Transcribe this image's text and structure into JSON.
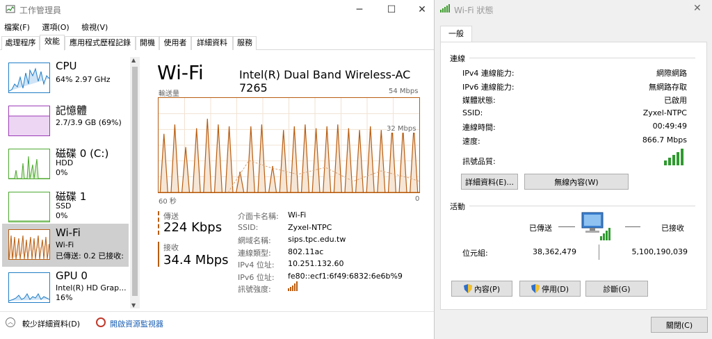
{
  "task_manager": {
    "title": "工作管理員",
    "menu": [
      "檔案(F)",
      "選項(O)",
      "檢視(V)"
    ],
    "tabs": [
      "處理程序",
      "效能",
      "應用程式歷程記錄",
      "開機",
      "使用者",
      "詳細資料",
      "服務"
    ],
    "active_tab": "效能",
    "sidebar": [
      {
        "title": "CPU",
        "line1": "64%  2.97 GHz",
        "line2": "",
        "color": "#1f7dc5"
      },
      {
        "title": "記憶體",
        "line1": "2.7/3.9 GB (69%)",
        "line2": "",
        "color": "#9b3ab5"
      },
      {
        "title": "磁碟 0 (C:)",
        "line1": "HDD",
        "line2": "0%",
        "color": "#4ca82e"
      },
      {
        "title": "磁碟 1",
        "line1": "SSD",
        "line2": "0%",
        "color": "#4ca82e"
      },
      {
        "title": "Wi-Fi",
        "line1": "Wi-Fi",
        "line2": "已傳送: 0.2  已接收: 3",
        "color": "#b85c0f"
      },
      {
        "title": "GPU 0",
        "line1": "Intel(R) HD Grap...",
        "line2": "16%",
        "color": "#1f7dc5"
      }
    ],
    "panel": {
      "heading": "Wi-Fi",
      "adapter": "Intel(R) Dual Band Wireless-AC 7265",
      "graph_label": "輸送量",
      "graph_max": "54 Mbps",
      "graph_mid": "32 Mbps",
      "graph_left": "60 秒",
      "graph_right": "0",
      "send_label": "傳送",
      "send_value": "224 Kbps",
      "recv_label": "接收",
      "recv_value": "34.4 Mbps",
      "details": [
        {
          "k": "介面卡名稱:",
          "v": "Wi-Fi"
        },
        {
          "k": "SSID:",
          "v": "Zyxel-NTPC"
        },
        {
          "k": "網域名稱:",
          "v": "sips.tpc.edu.tw"
        },
        {
          "k": "連線類型:",
          "v": "802.11ac"
        },
        {
          "k": "IPv4 位址:",
          "v": "10.251.132.60"
        },
        {
          "k": "IPv6 位址:",
          "v": "fe80::ecf1:6f49:6832:6e6b%9"
        },
        {
          "k": "訊號強度:",
          "v": ""
        }
      ]
    },
    "footer": {
      "fewer_details": "較少詳細資料(D)",
      "open_monitor": "開啟資源監視器"
    }
  },
  "wifi_status": {
    "title": "Wi-Fi 狀態",
    "tab": "一般",
    "connection_group": "連線",
    "rows": [
      {
        "k": "IPv4 連線能力:",
        "v": "網際網路"
      },
      {
        "k": "IPv6 連線能力:",
        "v": "無網路存取"
      },
      {
        "k": "媒體狀態:",
        "v": "已啟用"
      },
      {
        "k": "SSID:",
        "v": "Zyxel-NTPC"
      },
      {
        "k": "連線時間:",
        "v": "00:49:49"
      },
      {
        "k": "速度:",
        "v": "866.7 Mbps"
      }
    ],
    "signal_label": "訊號品質:",
    "details_button": "詳細資料(E)...",
    "wireless_button": "無線內容(W)",
    "activity_group": "活動",
    "sent_label": "已傳送",
    "recv_label": "已接收",
    "bytes_label": "位元組:",
    "bytes_sent": "38,362,479",
    "bytes_recv": "5,100,190,039",
    "properties_button": "內容(P)",
    "disable_button": "停用(D)",
    "diagnose_button": "診斷(G)",
    "close_button": "關閉(C)"
  }
}
